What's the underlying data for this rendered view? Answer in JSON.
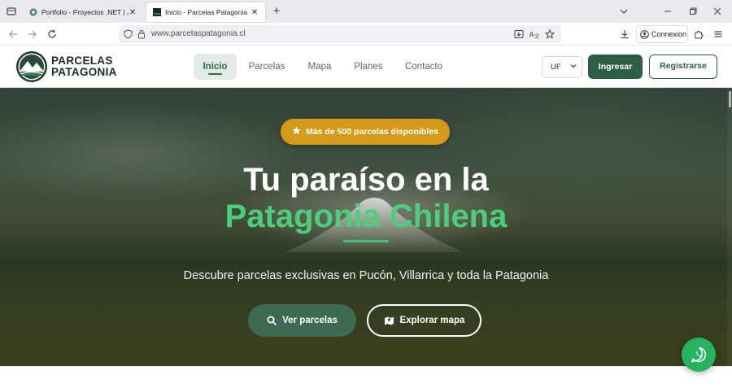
{
  "browser": {
    "tabs": [
      {
        "title": "Portfolio - Proyectos .NET | Jerom",
        "active": false
      },
      {
        "title": "Inicio - Parcelas Patagonia",
        "active": true
      }
    ],
    "url": "www.parcelaspatagonia.cl",
    "signin_label": "Connexion"
  },
  "header": {
    "logo_line1": "PARCELAS",
    "logo_line2": "PATAGONIA",
    "nav": [
      {
        "label": "Inicio",
        "active": true
      },
      {
        "label": "Parcelas",
        "active": false
      },
      {
        "label": "Mapa",
        "active": false
      },
      {
        "label": "Planes",
        "active": false
      },
      {
        "label": "Contacto",
        "active": false
      }
    ],
    "currency": "UF",
    "login_label": "Ingresar",
    "register_label": "Registrarse"
  },
  "hero": {
    "badge": "Más de 500 parcelas disponibles",
    "title_line1": "Tu paraíso en la",
    "title_line2": "Patagonia Chilena",
    "subtitle": "Descubre parcelas exclusivas en Pucón, Villarrica y toda la Patagonia",
    "cta_primary": "Ver parcelas",
    "cta_secondary": "Explorar mapa"
  },
  "colors": {
    "brand_green": "#2e5f46",
    "accent_green": "#4ad07b",
    "badge_gold": "#d49a18",
    "whatsapp_green": "#25b35d"
  }
}
